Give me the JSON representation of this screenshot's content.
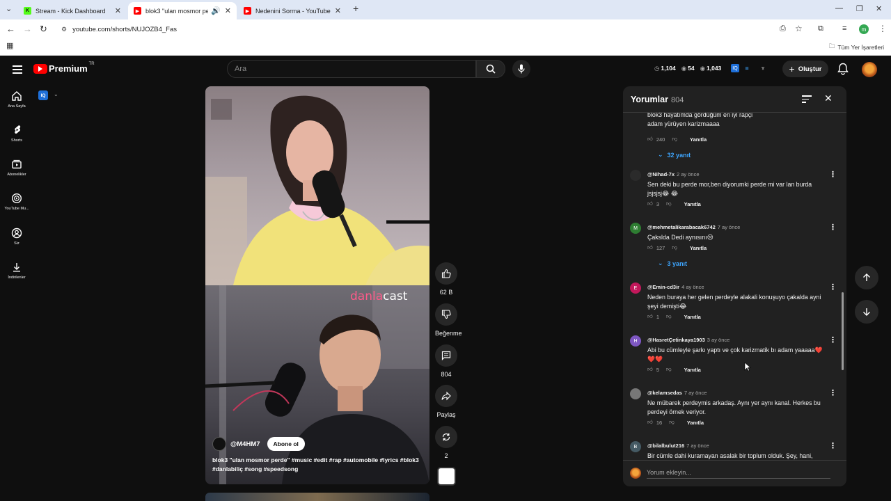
{
  "browser": {
    "tabs": [
      {
        "title": "Stream - Kick Dashboard",
        "favicon": "kick-icon",
        "color": "#53fc18"
      },
      {
        "title": "blok3 \"ulan mosmor perde\"",
        "favicon": "youtube-icon",
        "color": "#ff0000"
      },
      {
        "title": "Nedenini Sorma - YouTube",
        "favicon": "youtube-icon",
        "color": "#ff0000"
      }
    ],
    "url": "youtube.com/shorts/NUJOZB4_Fas",
    "bookmarks_label": "Tüm Yer İşaretleri",
    "profile_initial": "m"
  },
  "header": {
    "logo_text": "Premium",
    "logo_region": "TR",
    "search_placeholder": "Ara",
    "stats": [
      {
        "icon": "clock-icon",
        "value": "1,104"
      },
      {
        "icon": "eye-icon",
        "value": "54"
      },
      {
        "icon": "eye-icon",
        "value": "1,043"
      }
    ],
    "create_label": "Oluştur"
  },
  "sidebar": {
    "items": [
      {
        "label": "Ana Sayfa",
        "icon": "home-icon"
      },
      {
        "label": "Shorts",
        "icon": "shorts-icon"
      },
      {
        "label": "Abonelikler",
        "icon": "subscriptions-icon"
      },
      {
        "label": "YouTube Mu...",
        "icon": "youtube-music-icon"
      },
      {
        "label": "Siz",
        "icon": "you-icon"
      },
      {
        "label": "İndirilenler",
        "icon": "downloads-icon"
      }
    ],
    "extension_badge": "IQ"
  },
  "short": {
    "brand_watermark_a": "danla",
    "brand_watermark_b": "cast",
    "channel": "@M4HM7",
    "subscribe_label": "Abone ol",
    "caption_title": "blok3 \"ulan mosmor perde\"",
    "caption_tags": "#music #edit #rap #automobile #lyrics #blok3 #danlabiliç #song #speedsong"
  },
  "actions": {
    "like_count": "62 B",
    "dislike_label": "Beğenme",
    "comment_count": "804",
    "share_label": "Paylaş",
    "remix_count": "2"
  },
  "comments": {
    "title": "Yorumlar",
    "count": "804",
    "input_placeholder": "Yorum ekleyin...",
    "reply_label": "Yanıtla",
    "first": {
      "text_line1": "blok3 hayatımda gördüğüm en iyi rapçi",
      "text_line2": "adam yürüyen karizmaaaa",
      "likes": "240",
      "replies": "32 yanıt"
    },
    "items": [
      {
        "user": "@Nihad-7x",
        "time": "2 ay önce",
        "avatar": "",
        "avatar_color": "#2b2b2b",
        "line1": "Sen deki bu perde mor,ben diyorumki perde mi var lan burda",
        "line2": "jsjsjsj😂 😂",
        "likes": "3",
        "replies": ""
      },
      {
        "user": "@mehmetalikarabacak6742",
        "time": "7 ay önce",
        "avatar": "M",
        "avatar_color": "#2e7d32",
        "line1": "Çakslda Dedi aynısını😢",
        "line2": "",
        "likes": "127",
        "replies": "3 yanıt"
      },
      {
        "user": "@Emin-cd3ir",
        "time": "4 ay önce",
        "avatar": "E",
        "avatar_color": "#c2185b",
        "line1": "Neden buraya her gelen perdeyle alakali konuşuyo çakalda ayni",
        "line2": "şeyi demişti😂",
        "likes": "1",
        "replies": ""
      },
      {
        "user": "@HasretÇetinkaya1903",
        "time": "3 ay önce",
        "avatar": "H",
        "avatar_color": "#7e57c2",
        "line1": "Abi bu cümleyle şarkı yaptı ve çok karizmatik bı adam yaaaaa❤️",
        "line2": "❤️❤️",
        "likes": "5",
        "replies": ""
      },
      {
        "user": "@kelamsedas",
        "time": "7 ay önce",
        "avatar": "",
        "avatar_color": "#777777",
        "line1": "Ne mübarek perdeymis arkadaş. Aynı yer aynı kanal. Herkes bu",
        "line2": "perdeyi örnek veriyor.",
        "likes": "16",
        "replies": ""
      },
      {
        "user": "@bilalbulut216",
        "time": "7 ay önce",
        "avatar": "B",
        "avatar_color": "#455a64",
        "line1": "Bir cümle dahi kuramayan asalak bir toplum olduk. Şey, hani,",
        "line2": "",
        "likes": "",
        "replies": ""
      }
    ]
  }
}
